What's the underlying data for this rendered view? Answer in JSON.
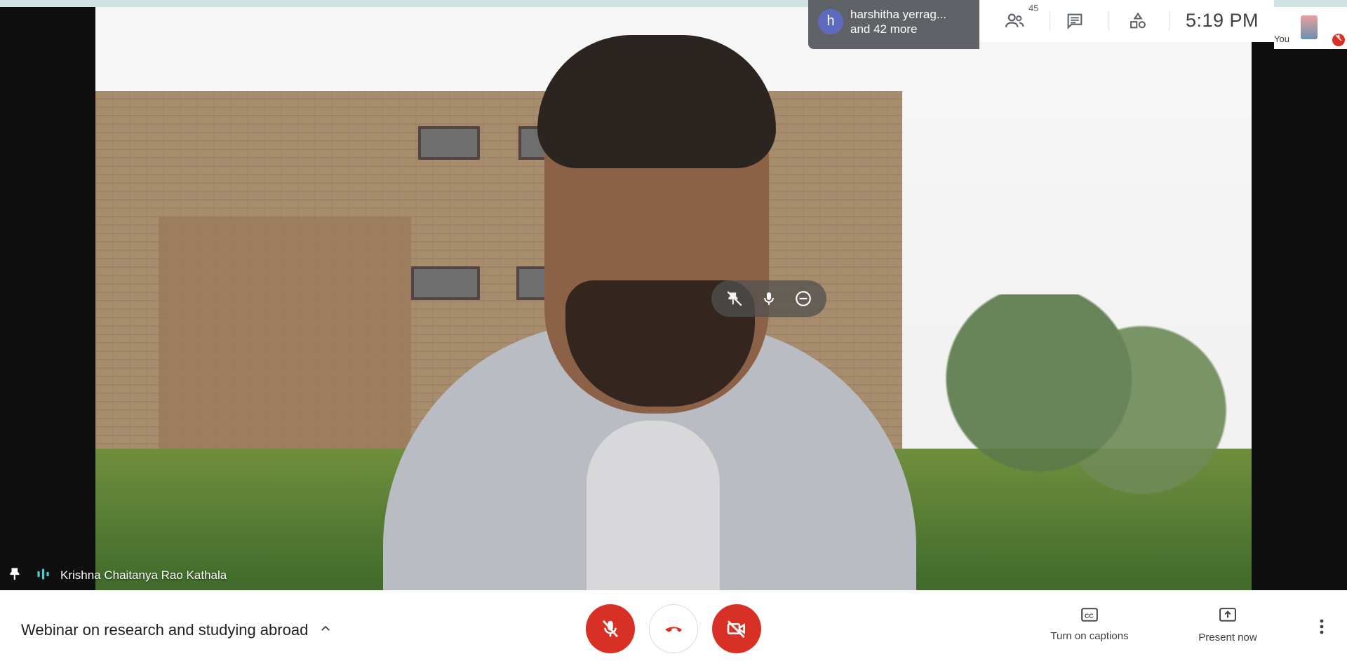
{
  "participants": {
    "avatar_letter": "h",
    "name": "harshitha yerrag...",
    "more": "and 42 more",
    "count": "45"
  },
  "topbar": {
    "time": "5:19  PM",
    "self_label": "You"
  },
  "speaker": {
    "name": "Krishna Chaitanya Rao Kathala"
  },
  "meeting": {
    "title": "Webinar on research and studying abroad"
  },
  "actions": {
    "captions_label": "Turn on captions",
    "present_label": "Present now"
  },
  "colors": {
    "accent_red": "#d93025",
    "dark_panel": "#5f6368",
    "avatar": "#5c6bc0"
  }
}
